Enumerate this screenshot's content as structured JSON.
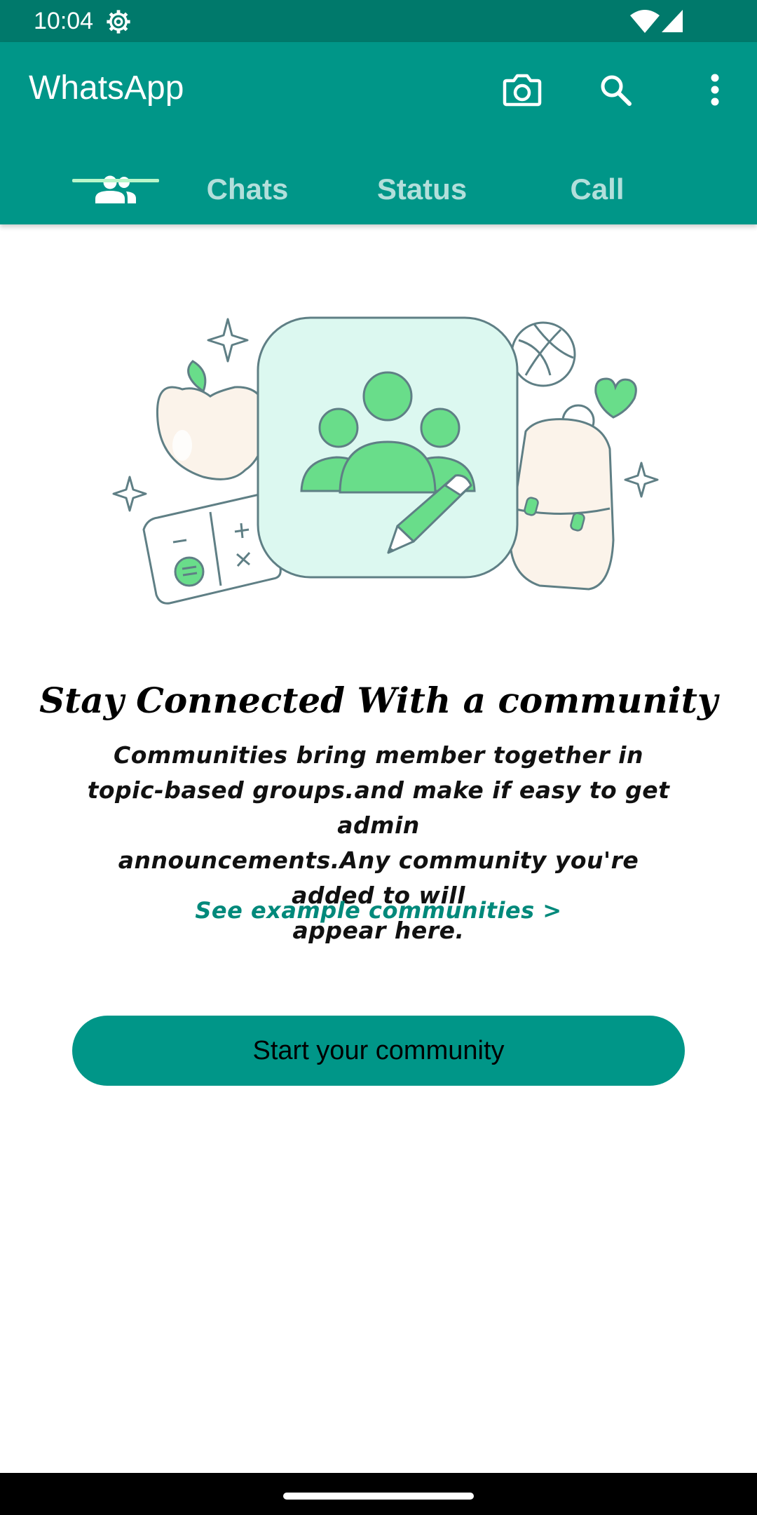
{
  "status_bar": {
    "time": "10:04",
    "icons": [
      "settings-gear-icon",
      "wifi-icon",
      "signal-icon"
    ]
  },
  "app_bar": {
    "title": "WhatsApp",
    "actions": [
      "camera-icon",
      "search-icon",
      "more-vert-icon"
    ],
    "background_color": "#009688"
  },
  "tabs": [
    {
      "icon": "community-icon",
      "selected": true
    },
    {
      "label": "Chats",
      "selected": false
    },
    {
      "label": "Status",
      "selected": false
    },
    {
      "label": "Call",
      "selected": false
    }
  ],
  "main": {
    "heading": "Stay Connected With a community",
    "body_lines": [
      "Communities bring member together in",
      "topic-based groups.and make if easy to get admin",
      "announcements.Any community you're added to will",
      "appear here."
    ],
    "link": "See example communities >",
    "button_label": "Start your community"
  },
  "colors": {
    "status_bar": "#00796B",
    "accent": "#009688",
    "tab_indicator": "#B9F6CA",
    "link": "#00897B"
  }
}
